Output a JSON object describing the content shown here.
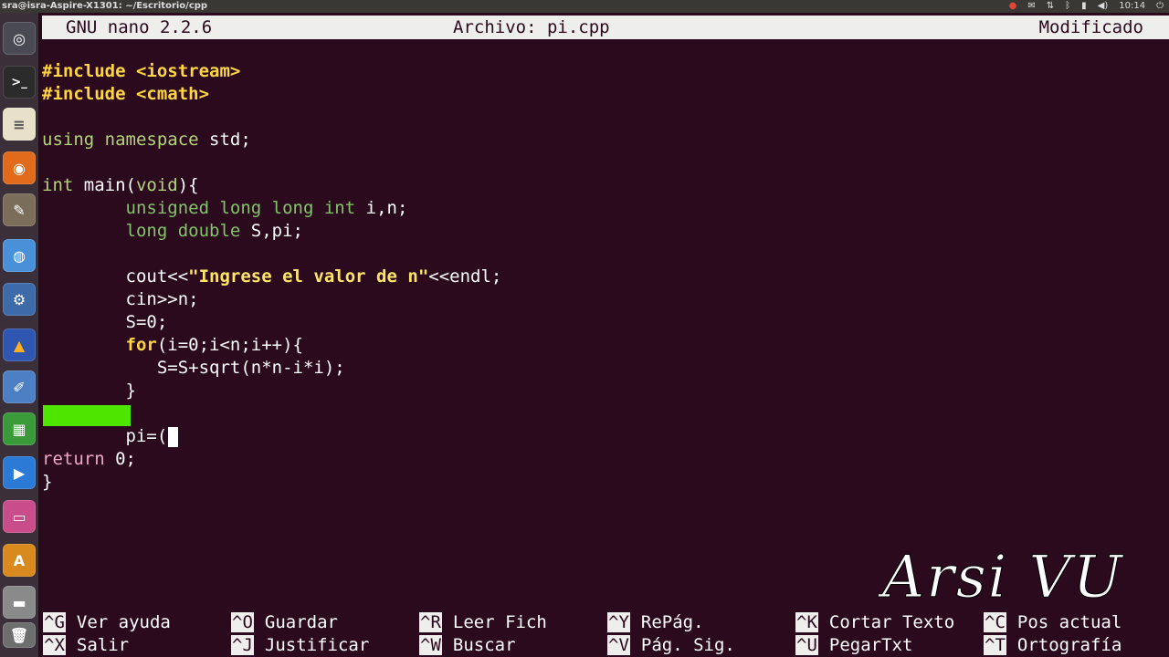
{
  "window_title": "sra@isra-Aspire-X1301: ~/Escritorio/cpp",
  "tray": {
    "clock": "10:14"
  },
  "nano": {
    "version": "GNU nano 2.2.6",
    "file": "Archivo: pi.cpp",
    "status": "Modificado"
  },
  "code": {
    "l1": {
      "kw": "#include",
      "arg": "<iostream>"
    },
    "l2": {
      "kw": "#include",
      "arg": "<cmath>"
    },
    "l4": {
      "a": "using namespace",
      "b": " std;"
    },
    "l6": {
      "a": "int",
      "b": " main(",
      "c": "void",
      "d": "){"
    },
    "l7": {
      "a": "unsigned long long int",
      "b": " i,n;"
    },
    "l8": {
      "a": "long double",
      "b": " S,pi;"
    },
    "l10": {
      "a": "cout<<",
      "b": "\"Ingrese el valor de n\"",
      "c": "<<endl;"
    },
    "l11": "cin>>n;",
    "l12": "S=0;",
    "l13": {
      "a": "for",
      "b": "(i=0;i<n;i++){"
    },
    "l14": "S=S+sqrt(n*n-i*i);",
    "l15": "}",
    "l17": "pi=(",
    "l18": {
      "a": "return",
      "b": " 0;"
    },
    "l19": "}"
  },
  "shortcuts": [
    {
      "key": "^G",
      "label": "Ver ayuda"
    },
    {
      "key": "^O",
      "label": "Guardar"
    },
    {
      "key": "^R",
      "label": "Leer Fich"
    },
    {
      "key": "^Y",
      "label": "RePág."
    },
    {
      "key": "^K",
      "label": "Cortar Texto"
    },
    {
      "key": "^C",
      "label": "Pos actual"
    },
    {
      "key": "^X",
      "label": "Salir"
    },
    {
      "key": "^J",
      "label": "Justificar"
    },
    {
      "key": "^W",
      "label": "Buscar"
    },
    {
      "key": "^V",
      "label": "Pág. Sig."
    },
    {
      "key": "^U",
      "label": "PegarTxt"
    },
    {
      "key": "^T",
      "label": "Ortografía"
    }
  ],
  "watermark": "Arsi VU",
  "launcher_icons": [
    "dash-icon",
    "terminal-icon",
    "text-editor-icon",
    "firefox-icon",
    "gimp-icon",
    "chromium-icon",
    "settings-icon",
    "flame-app-icon",
    "pen-app-icon",
    "calc-icon",
    "media-player-icon",
    "presentation-icon",
    "software-center-icon",
    "drive-icon",
    "trash-icon"
  ]
}
